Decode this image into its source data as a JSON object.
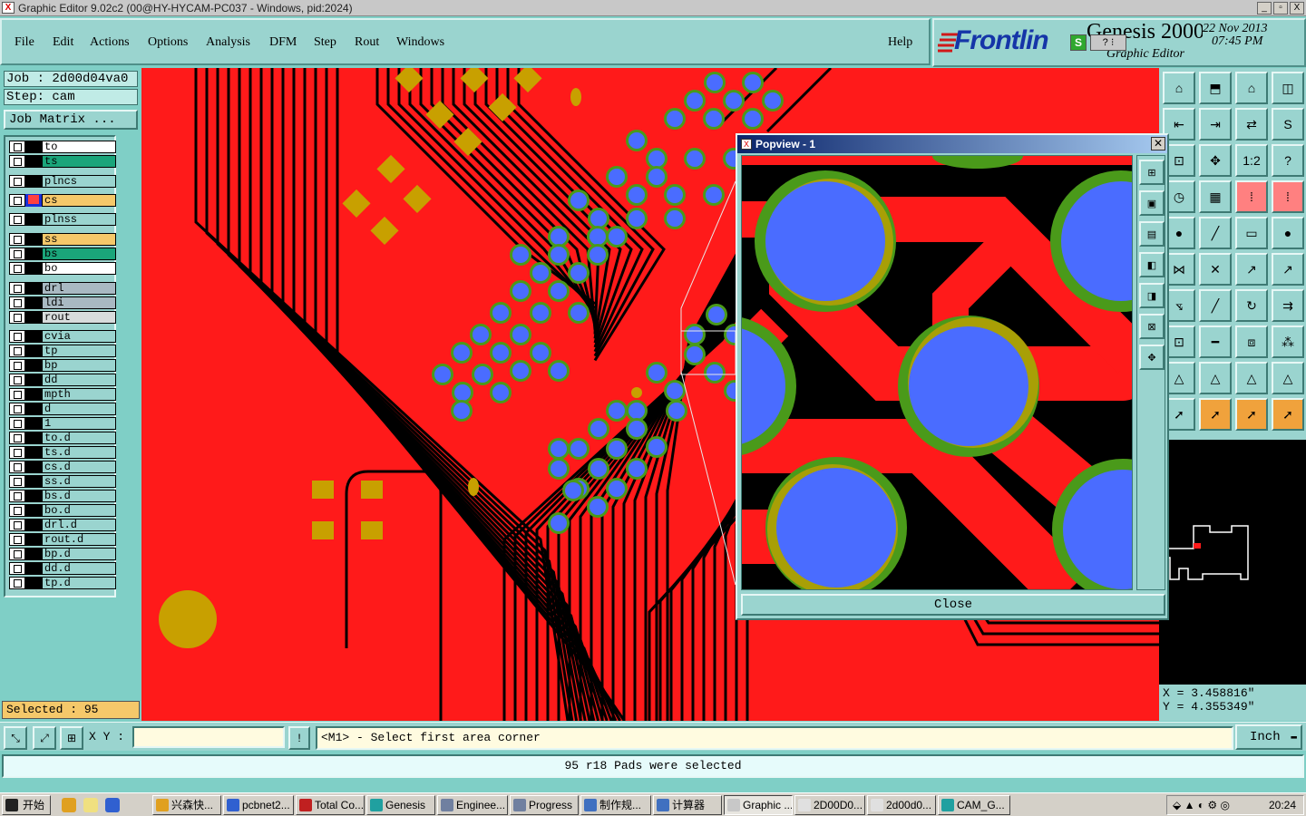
{
  "window": {
    "title": "Graphic Editor 9.02c2 (00@HY-HYCAM-PC037 - Windows, pid:2024)",
    "controls": [
      "_",
      "▫",
      "X"
    ]
  },
  "menu": {
    "items": [
      "File",
      "Edit",
      "Actions",
      "Options",
      "Analysis",
      "DFM",
      "Step",
      "Rout",
      "Windows"
    ],
    "help": "Help"
  },
  "brand": {
    "logo": "Frontlin",
    "product": "Genesis 2000",
    "subtitle": "Graphic Editor",
    "date": "22 Nov 2013",
    "time": "07:45 PM"
  },
  "job": {
    "job_label": "Job : 2d00d04va0",
    "step_label": "Step: cam",
    "matrix_button": "Job Matrix ..."
  },
  "layers": [
    {
      "name": "to",
      "color": "#ffffff"
    },
    {
      "name": "ts",
      "color": "#1aa57a"
    },
    {
      "name": "plncs",
      "color": "#9ad4cf"
    },
    {
      "name": "cs",
      "color": "#f5c86a",
      "active": true
    },
    {
      "name": "plnss",
      "color": "#9ad4cf"
    },
    {
      "name": "ss",
      "color": "#f5c86a"
    },
    {
      "name": "bs",
      "color": "#1aa57a"
    },
    {
      "name": "bo",
      "color": "#ffffff"
    },
    {
      "name": "drl",
      "color": "#a9b9c2"
    },
    {
      "name": "ldi",
      "color": "#a9b9c2"
    },
    {
      "name": "rout",
      "color": "#d8dcdc"
    },
    {
      "name": "cvia",
      "color": "#9ad4cf"
    },
    {
      "name": "tp",
      "color": "#9ad4cf"
    },
    {
      "name": "bp",
      "color": "#9ad4cf"
    },
    {
      "name": "dd",
      "color": "#9ad4cf"
    },
    {
      "name": "mpth",
      "color": "#9ad4cf"
    },
    {
      "name": "d",
      "color": "#9ad4cf"
    },
    {
      "name": "1",
      "color": "#9ad4cf"
    },
    {
      "name": "to.d",
      "color": "#9ad4cf"
    },
    {
      "name": "ts.d",
      "color": "#9ad4cf"
    },
    {
      "name": "cs.d",
      "color": "#9ad4cf"
    },
    {
      "name": "ss.d",
      "color": "#9ad4cf"
    },
    {
      "name": "bs.d",
      "color": "#9ad4cf"
    },
    {
      "name": "bo.d",
      "color": "#9ad4cf"
    },
    {
      "name": "drl.d",
      "color": "#9ad4cf"
    },
    {
      "name": "rout.d",
      "color": "#9ad4cf"
    },
    {
      "name": "bp.d",
      "color": "#9ad4cf"
    },
    {
      "name": "dd.d",
      "color": "#9ad4cf"
    },
    {
      "name": "tp.d",
      "color": "#9ad4cf"
    }
  ],
  "selected": "Selected : 95",
  "popview": {
    "title": "Popview - 1",
    "close": "Close"
  },
  "coords": {
    "x": "X = 3.458816\"",
    "y": "Y = 4.355349\""
  },
  "command": {
    "xy_label": "X Y :",
    "xy_value": "",
    "prompt": "<M1> - Select first area corner",
    "units": "Inch"
  },
  "status": "95 r18 Pads were selected",
  "taskbar": {
    "start": "开始",
    "tasks": [
      "兴森快...",
      "pcbnet2...",
      "Total Co...",
      "Genesis",
      "Enginee...",
      "Progress",
      "制作规...",
      "计算器",
      "Graphic ...",
      "2D00D0...",
      "2d00d0...",
      "CAM_G..."
    ],
    "clock": "20:24"
  },
  "colors": {
    "copper": "#ff1a1a",
    "pad_gold": "#c8a000",
    "via_blue": "#4a6cff",
    "ring_green": "#4a9a1a",
    "panel": "#9ad4cf"
  }
}
